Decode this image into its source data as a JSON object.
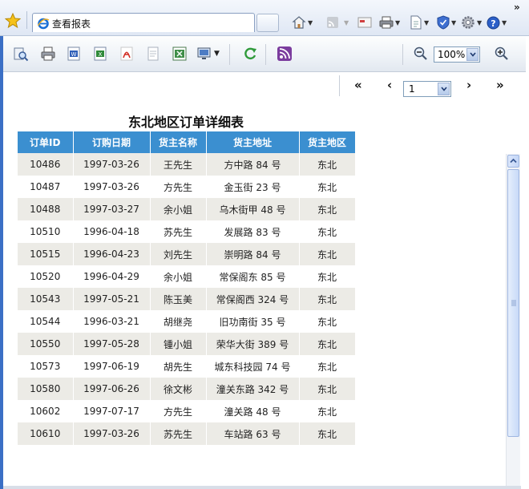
{
  "browser": {
    "tab_title": "查看报表",
    "chevron": "»",
    "icons": [
      "favorites-star-icon",
      "ie-page-icon",
      "home-icon",
      "rss-feed-icon",
      "read-mail-icon",
      "print-icon",
      "page-icon",
      "safety-icon",
      "tools-gear-icon",
      "help-icon"
    ]
  },
  "toolbar": {
    "zoom_value": "100%",
    "icons": [
      "find-icon",
      "print-icon",
      "export-word-icon",
      "export-excel-icon",
      "export-pdf-icon",
      "export-text-icon",
      "export-excel-data-icon",
      "display-mode-icon",
      "refresh-icon",
      "rss-icon",
      "zoom-out-icon",
      "zoom-in-icon"
    ]
  },
  "nav": {
    "first": "«",
    "prev": "‹",
    "page_value": "1",
    "next": "›",
    "last": "»"
  },
  "report": {
    "title": "东北地区订单详细表",
    "header_color": "#3b8fd0",
    "alt_row_color": "#ecebe6",
    "columns": [
      "订单ID",
      "订购日期",
      "货主名称",
      "货主地址",
      "货主地区"
    ],
    "rows": [
      [
        "10486",
        "1997-03-26",
        "王先生",
        "方中路 84 号",
        "东北"
      ],
      [
        "10487",
        "1997-03-26",
        "方先生",
        "金玉街 23 号",
        "东北"
      ],
      [
        "10488",
        "1997-03-27",
        "余小姐",
        "乌木街甲 48 号",
        "东北"
      ],
      [
        "10510",
        "1996-04-18",
        "苏先生",
        "发展路 83 号",
        "东北"
      ],
      [
        "10515",
        "1996-04-23",
        "刘先生",
        "崇明路 84 号",
        "东北"
      ],
      [
        "10520",
        "1996-04-29",
        "余小姐",
        "常保阁东 85 号",
        "东北"
      ],
      [
        "10543",
        "1997-05-21",
        "陈玉美",
        "常保阁西 324 号",
        "东北"
      ],
      [
        "10544",
        "1996-03-21",
        "胡继尧",
        "旧功南街 35 号",
        "东北"
      ],
      [
        "10550",
        "1997-05-28",
        "锺小姐",
        "荣华大街 389 号",
        "东北"
      ],
      [
        "10573",
        "1997-06-19",
        "胡先生",
        "城东科技园 74 号",
        "东北"
      ],
      [
        "10580",
        "1997-06-26",
        "徐文彬",
        "潼关东路 342 号",
        "东北"
      ],
      [
        "10602",
        "1997-07-17",
        "方先生",
        "潼关路 48 号",
        "东北"
      ],
      [
        "10610",
        "1997-03-26",
        "苏先生",
        "车站路 63 号",
        "东北"
      ]
    ]
  }
}
